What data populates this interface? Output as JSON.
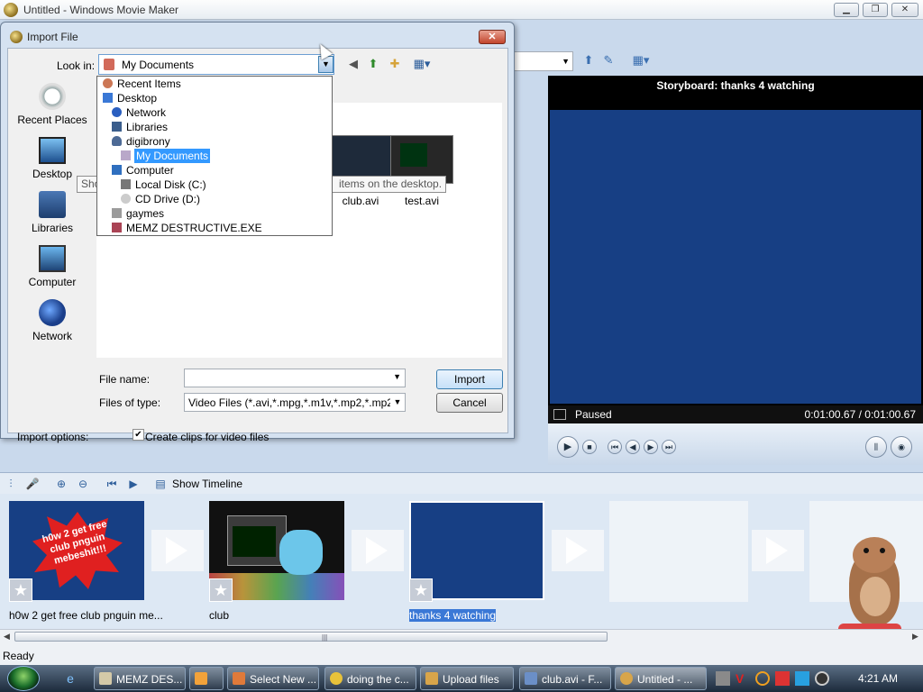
{
  "main_window": {
    "title": "Untitled - Windows Movie Maker",
    "min_label": "▁",
    "max_label": "❐",
    "close_label": "✕"
  },
  "monitor": {
    "title": "Storyboard: thanks 4 watching",
    "status": "Paused",
    "time": "0:01:00.67 / 0:01:00.67"
  },
  "storyboard": {
    "toolbar": {
      "show_timeline": "Show Timeline"
    },
    "clips": [
      {
        "label": "h0w 2 get free club pnguin me...",
        "overlay_text": "h0w 2 get free club pnguin mebeshit!!!"
      },
      {
        "label": "club"
      },
      {
        "label": "thanks 4 watching"
      }
    ]
  },
  "status_bar": {
    "text": "Ready"
  },
  "dialog": {
    "title": "Import File",
    "close_label": "✕",
    "look_in_label": "Look in:",
    "look_in_value": "My Documents",
    "places": [
      {
        "label": "Recent Places"
      },
      {
        "label": "Desktop"
      },
      {
        "label": "Libraries"
      },
      {
        "label": "Computer"
      },
      {
        "label": "Network"
      }
    ],
    "files": [
      {
        "name": "club.avi"
      },
      {
        "name": "test.avi"
      }
    ],
    "tooltip": {
      "left": "Show",
      "right": "items on the desktop."
    },
    "file_name_label": "File name:",
    "file_name_value": "",
    "files_of_type_label": "Files of type:",
    "files_of_type_value": "Video Files (*.avi,*.mpg,*.m1v,*.mp2,*.mp2v,*.m",
    "import_button": "Import",
    "cancel_button": "Cancel",
    "import_options_label": "Import options:",
    "create_clips_label": "Create clips for video files",
    "create_clips_checked": true,
    "look_in_options": [
      "Recent Items",
      "Desktop",
      "Network",
      "Libraries",
      "digibrony",
      "My Documents",
      "Computer",
      "Local Disk (C:)",
      "CD Drive (D:)",
      "gaymes",
      "MEMZ DESTRUCTIVE.EXE"
    ]
  },
  "taskbar": {
    "tasks": [
      {
        "label": "MEMZ DES..."
      },
      {
        "label": ""
      },
      {
        "label": "Select New ..."
      },
      {
        "label": "doing the c..."
      },
      {
        "label": "Upload files"
      },
      {
        "label": "club.avi - F..."
      },
      {
        "label": "Untitled - ..."
      }
    ],
    "clock": "4:21 AM"
  },
  "colors": {
    "monitor_screen": "#173f84",
    "selection": "#3399ff",
    "taskbar": "#1c2a3b"
  }
}
